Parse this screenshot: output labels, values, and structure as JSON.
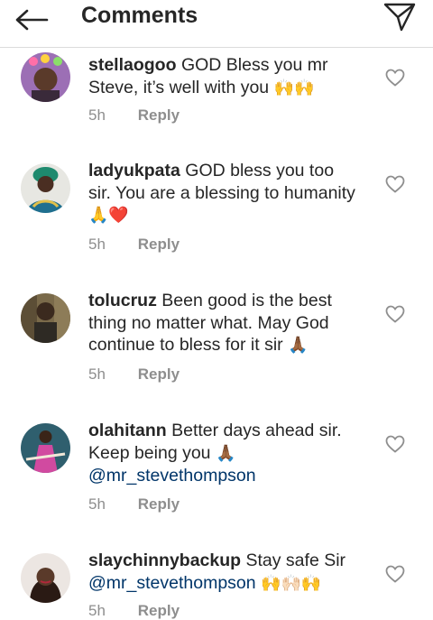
{
  "header": {
    "title": "Comments"
  },
  "comments": [
    {
      "username": "stellaogoo",
      "text": "GOD Bless you mr Steve, it’s well with you",
      "emojis": "🙌🙌",
      "time": "5h",
      "reply": "Reply",
      "avatar_color": "#8a5fa6"
    },
    {
      "username": "ladyukpata",
      "text": "GOD bless you too sir. You are a blessing to humanity",
      "emojis": "🙏❤️",
      "time": "5h",
      "reply": "Reply",
      "avatar_color": "#1e7d6a"
    },
    {
      "username": "tolucruz",
      "text": "Been good is the best thing no matter what. May God continue to bless for it sir",
      "emojis": "🙏🏾",
      "time": "5h",
      "reply": "Reply",
      "avatar_color": "#6b5a3c"
    },
    {
      "username": "olahitann",
      "text": "Better days ahead sir. Keep being you",
      "emojis": "🙏🏾",
      "mention": "@mr_stevethompson",
      "time": "5h",
      "reply": "Reply",
      "avatar_color": "#3a6f7d"
    },
    {
      "username": "slaychinnybackup",
      "text": "Stay safe Sir",
      "mention": "@mr_stevethompson",
      "emojis": "🙌🙌🏻🙌",
      "time": "5h",
      "reply": "Reply",
      "avatar_color": "#3b2a22"
    }
  ]
}
